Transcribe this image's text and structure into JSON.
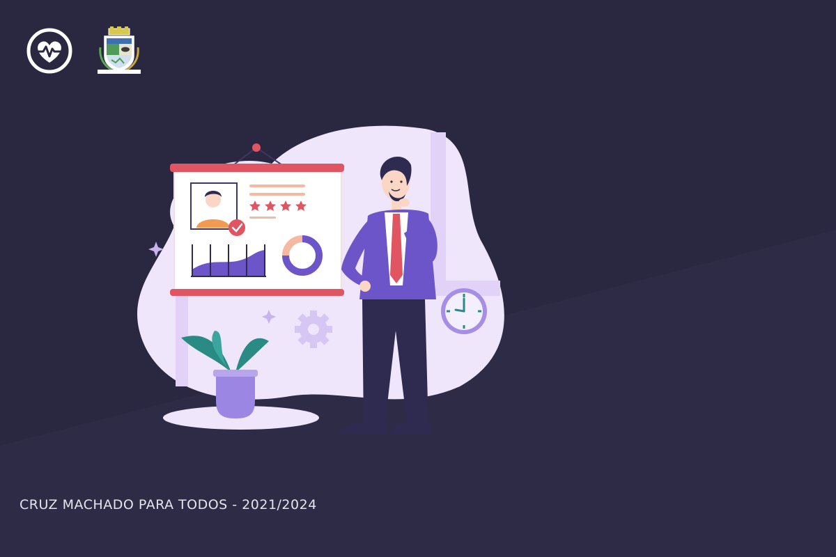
{
  "footer": {
    "text": "CRUZ MACHADO PARA TODOS - 2021/2024"
  },
  "logos": {
    "health_icon": "heart-pulse-icon",
    "crest_icon": "municipal-crest-icon"
  },
  "illustration": {
    "stars_rating": 4,
    "stars_max": 4,
    "donut_fraction": 0.75
  },
  "colors": {
    "background": "#2a2740",
    "background_shade": "#2e2b47",
    "blob": "#efe6fb",
    "accent_purple": "#6c55c9",
    "accent_red": "#e05561",
    "accent_orange": "#f29a52",
    "plant_green": "#2a8b85"
  }
}
